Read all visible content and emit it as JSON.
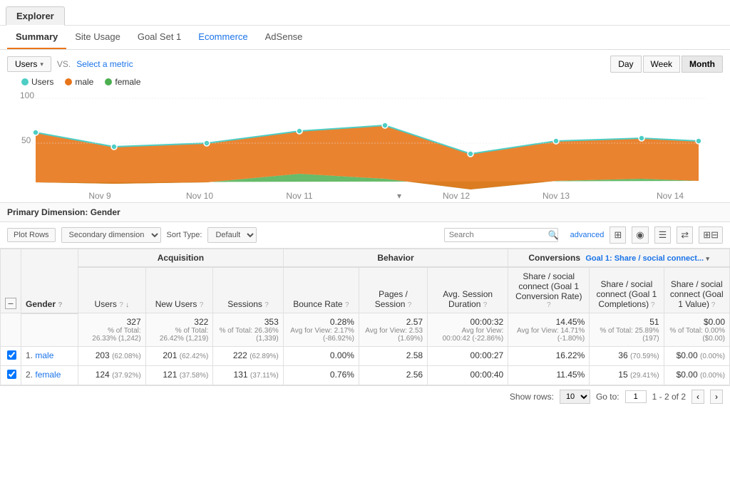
{
  "explorer_tab": "Explorer",
  "subtabs": [
    {
      "label": "Summary",
      "active": true,
      "link": false
    },
    {
      "label": "Site Usage",
      "active": false,
      "link": false
    },
    {
      "label": "Goal Set 1",
      "active": false,
      "link": false
    },
    {
      "label": "Ecommerce",
      "active": false,
      "link": true
    },
    {
      "label": "AdSense",
      "active": false,
      "link": false
    }
  ],
  "chart": {
    "metric_btn_label": "Users",
    "vs_text": "VS.",
    "select_metric_label": "Select a metric",
    "time_buttons": [
      "Day",
      "Week",
      "Month"
    ],
    "active_time": "Day",
    "legend": [
      {
        "label": "Users",
        "color": "#4ecdc4"
      },
      {
        "label": "male",
        "color": "#e8751a"
      },
      {
        "label": "female",
        "color": "#4caf50"
      }
    ],
    "y_label": "100",
    "y_mid": "50",
    "x_labels": [
      "Nov 9",
      "Nov 10",
      "Nov 11",
      "Nov 12",
      "Nov 13",
      "Nov 14"
    ]
  },
  "primary_dimension": {
    "label": "Primary Dimension:",
    "value": "Gender"
  },
  "toolbar": {
    "plot_rows_label": "Plot Rows",
    "secondary_dim_label": "Secondary dimension",
    "sort_type_label": "Sort Type:",
    "sort_default": "Default",
    "search_placeholder": "Search",
    "advanced_label": "advanced"
  },
  "table": {
    "group_headers": {
      "acquisition": "Acquisition",
      "behavior": "Behavior",
      "conversions": "Conversions",
      "goal_label": "Goal 1: Share / social connect..."
    },
    "col_headers": [
      {
        "label": "Gender",
        "colspan": 1
      },
      {
        "label": "Users",
        "sort": true
      },
      {
        "label": "New Users"
      },
      {
        "label": "Sessions"
      },
      {
        "label": "Bounce Rate"
      },
      {
        "label": "Pages / Session"
      },
      {
        "label": "Avg. Session Duration"
      },
      {
        "label": "Share / social connect (Goal 1 Conversion Rate)"
      },
      {
        "label": "Share / social connect (Goal 1 Completions)"
      },
      {
        "label": "Share / social connect (Goal 1 Value)"
      }
    ],
    "total_row": {
      "label": "",
      "users": "327",
      "users_sub": "% of Total: 26.33% (1,242)",
      "new_users": "322",
      "new_users_sub": "% of Total: 26.42% (1,219)",
      "sessions": "353",
      "sessions_sub": "% of Total: 26.36% (1,339)",
      "bounce_rate": "0.28%",
      "bounce_sub": "Avg for View: 2.17% (-86.92%)",
      "pages_session": "2.57",
      "pages_sub": "Avg for View: 2.53 (1.69%)",
      "avg_duration": "00:00:32",
      "duration_sub": "Avg for View: 00:00:42 (-22.86%)",
      "conv_rate": "14.45%",
      "conv_sub": "Avg for View: 14.71% (-1.80%)",
      "completions": "51",
      "completions_sub": "% of Total: 25.89% (197)",
      "goal_value": "$0.00",
      "goal_value_sub": "% of Total: 0.00% ($0.00)"
    },
    "rows": [
      {
        "rank": "1.",
        "gender": "male",
        "checked": true,
        "users": "203",
        "users_pct": "(62.08%)",
        "new_users": "201",
        "new_users_pct": "(62.42%)",
        "sessions": "222",
        "sessions_pct": "(62.89%)",
        "bounce_rate": "0.00%",
        "pages_session": "2.58",
        "avg_duration": "00:00:27",
        "conv_rate": "16.22%",
        "completions": "36",
        "completions_pct": "(70.59%)",
        "goal_value": "$0.00",
        "goal_value_pct": "(0.00%)"
      },
      {
        "rank": "2.",
        "gender": "female",
        "checked": true,
        "users": "124",
        "users_pct": "(37.92%)",
        "new_users": "121",
        "new_users_pct": "(37.58%)",
        "sessions": "131",
        "sessions_pct": "(37.11%)",
        "bounce_rate": "0.76%",
        "pages_session": "2.56",
        "avg_duration": "00:00:40",
        "conv_rate": "11.45%",
        "completions": "15",
        "completions_pct": "(29.41%)",
        "goal_value": "$0.00",
        "goal_value_pct": "(0.00%)"
      }
    ]
  },
  "pagination": {
    "show_rows_label": "Show rows:",
    "rows_value": "10",
    "goto_label": "Go to:",
    "goto_value": "1",
    "range_label": "1 - 2 of 2"
  }
}
